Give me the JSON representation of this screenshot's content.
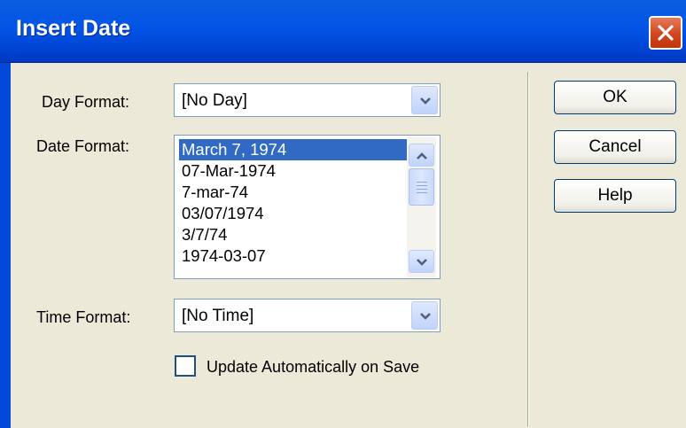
{
  "window": {
    "title": "Insert Date"
  },
  "day_format": {
    "label": "Day Format:",
    "value": "[No Day]"
  },
  "date_format": {
    "label": "Date Format:",
    "options": [
      "March 7, 1974",
      "07-Mar-1974",
      "7-mar-74",
      "03/07/1974",
      "3/7/74",
      "1974-03-07"
    ],
    "selected_index": 0
  },
  "time_format": {
    "label": "Time Format:",
    "value": "[No Time]"
  },
  "update_checkbox": {
    "label": "Update Automatically on Save",
    "checked": false
  },
  "buttons": {
    "ok": "OK",
    "cancel": "Cancel",
    "help": "Help"
  },
  "colors": {
    "title_bar": "#0054e3",
    "selection": "#316ac5",
    "dialog_bg": "#ece9d8",
    "close_button": "#d2461e"
  }
}
